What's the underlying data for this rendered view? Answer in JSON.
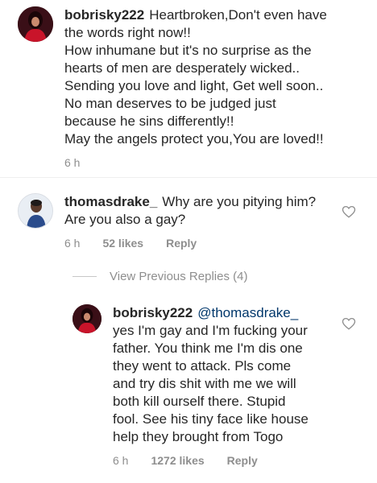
{
  "comments": [
    {
      "username": "bobrisky222",
      "text_lines": [
        "Heartbroken,Don't even have",
        "the words right now!!",
        "How inhumane but it's no surprise as the",
        "hearts of men are desperately wicked..",
        "Sending you love and light, Get well soon..",
        "No man deserves to be judged just",
        "because he sins differently!!",
        "May the angels protect you,You are loved!!"
      ],
      "time": "6 h"
    },
    {
      "username": "thomasdrake_",
      "text_lines": [
        "Why are you pitying him?",
        "Are you also a gay?"
      ],
      "time": "6 h",
      "likes": "52 likes",
      "reply": "Reply"
    }
  ],
  "view_previous": "View Previous Replies (4)",
  "reply_comment": {
    "username": "bobrisky222",
    "mention": "@thomasdrake_",
    "text_lines": [
      "yes I'm gay and I'm fucking your",
      "father. You think me I'm dis one",
      "they went to attack. Pls come",
      "and try dis shit with me we will",
      "both kill ourself there. Stupid",
      "fool. See his tiny face like house",
      "help they brought from Togo"
    ],
    "time": "6 h",
    "likes": "1272 likes",
    "reply": "Reply"
  }
}
